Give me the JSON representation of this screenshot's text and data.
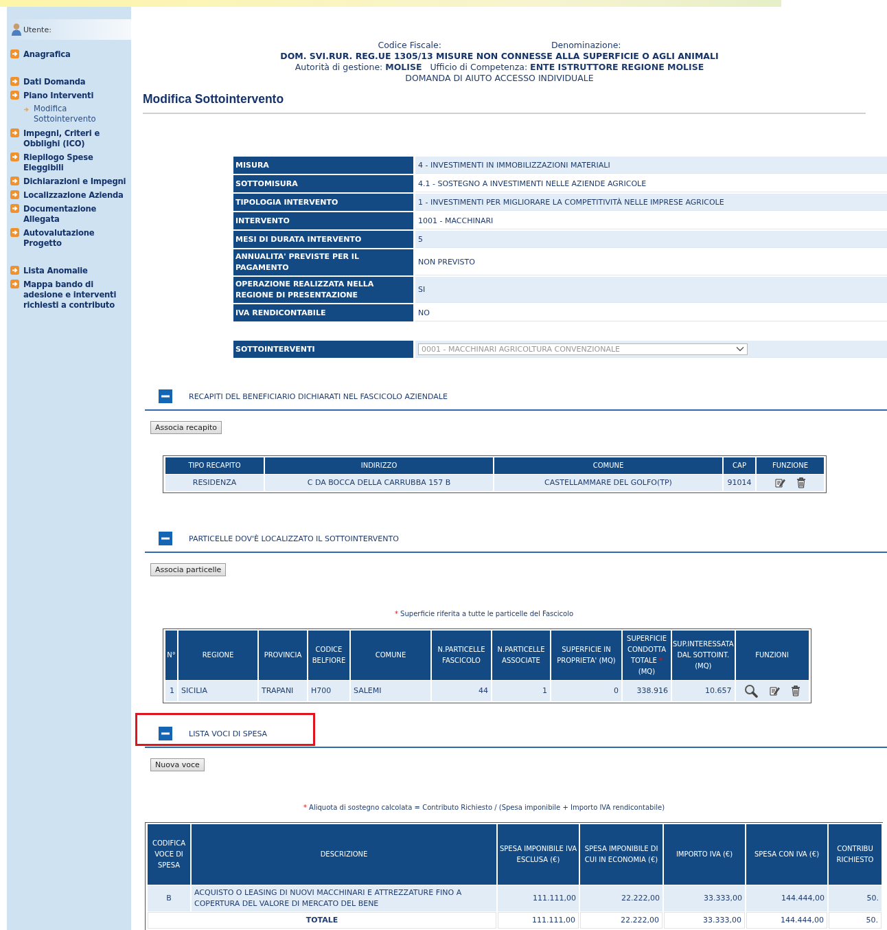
{
  "sidebar": {
    "user_label": "Utente:",
    "groups": [
      {
        "items": [
          {
            "label": "Anagrafica"
          }
        ]
      },
      {
        "items": [
          {
            "label": "Dati Domanda"
          },
          {
            "label": "Piano Interventi",
            "children": [
              {
                "label": "Modifica Sottointervento"
              }
            ]
          },
          {
            "label": "Impegni, Criteri e Obblighi (ICO)"
          },
          {
            "label": "Riepilogo Spese Eleggibili"
          },
          {
            "label": "Dichiarazioni e Impegni"
          },
          {
            "label": "Localizzazione Azienda"
          },
          {
            "label": "Documentazione Allegata"
          },
          {
            "label": "Autovalutazione Progetto"
          }
        ]
      },
      {
        "items": [
          {
            "label": "Lista Anomalie"
          },
          {
            "label": "Mappa bando di adesione e interventi richiesti a contributo"
          }
        ]
      }
    ]
  },
  "header": {
    "codice_fiscale_label": "Codice Fiscale:",
    "denominazione_label": "Denominazione:",
    "title": "DOM. SVI.RUR. REG.UE 1305/13 MISURE NON CONNESSE ALLA SUPERFICIE O AGLI ANIMALI",
    "authority": "Autorità di gestione: **MOLISE**   Ufficio di Competenza: **ENTE ISTRUTTORE REGIONE MOLISE**",
    "subtitle": "DOMANDA DI AIUTO ACCESSO INDIVIDUALE"
  },
  "page_title": "Modifica Sottointervento",
  "details": [
    {
      "label": "MISURA",
      "value": "4 - INVESTIMENTI IN IMMOBILIZZAZIONI MATERIALI"
    },
    {
      "label": "SOTTOMISURA",
      "value": "4.1 - SOSTEGNO A INVESTIMENTI NELLE AZIENDE AGRICOLE"
    },
    {
      "label": "TIPOLOGIA INTERVENTO",
      "value": "1 - INVESTIMENTI PER MIGLIORARE LA COMPETITIVITÀ NELLE IMPRESE AGRICOLE"
    },
    {
      "label": "INTERVENTO",
      "value": "1001 - MACCHINARI"
    },
    {
      "label": "MESI DI DURATA INTERVENTO",
      "value": "5"
    },
    {
      "label": "ANNUALITA' PREVISTE PER IL PAGAMENTO",
      "value": "NON PREVISTO"
    },
    {
      "label": "OPERAZIONE REALIZZATA NELLA REGIONE DI PRESENTAZIONE",
      "value": "SI"
    },
    {
      "label": "IVA RENDICONTABILE",
      "value": "NO"
    }
  ],
  "sottointerventi": {
    "label": "SOTTOINTERVENTI",
    "value": "0001 - MACCHINARI AGRICOLTURA CONVENZIONALE",
    "disabled": true
  },
  "sections": [
    {
      "title": "RECAPITI DEL BENEFICIARIO DICHIARATI NEL FASCICOLO AZIENDALE",
      "expanded": true,
      "button": "Associa recapito",
      "table": {
        "columns": [
          {
            "label": "TIPO RECAPITO",
            "kind": "center"
          },
          {
            "label": "INDIRIZZO",
            "kind": "center"
          },
          {
            "label": "COMUNE",
            "kind": "center"
          },
          {
            "label": "CAP",
            "kind": "center"
          },
          {
            "label": "FUNZIONE",
            "kind": "actions"
          }
        ],
        "rows": [
          {
            "cells": [
              "RESIDENZA",
              "C DA BOCCA DELLA CARRUBBA 157 B",
              "CASTELLAMMARE DEL GOLFO(TP)",
              "91014"
            ],
            "actions": [
              {
                "kind": "edit"
              },
              {
                "kind": "delete"
              }
            ]
          }
        ]
      }
    },
    {
      "title": "PARTICELLE DOV'È LOCALIZZATO IL SOTTOINTERVENTO",
      "expanded": true,
      "button": "Associa particelle",
      "note": {
        "mark": "*",
        "text": "Superficie riferita a tutte le particelle del Fascicolo"
      },
      "table": {
        "columns": [
          {
            "label": "N°",
            "kind": "number"
          },
          {
            "label": "REGIONE",
            "kind": "left"
          },
          {
            "label": "PROVINCIA",
            "kind": "left"
          },
          {
            "label": "CODICE BELFIORE",
            "kind": "left"
          },
          {
            "label": "COMUNE",
            "kind": "left"
          },
          {
            "label": "N.PARTICELLE FASCICOLO",
            "kind": "number"
          },
          {
            "label": "N.PARTICELLE ASSOCIATE",
            "kind": "number"
          },
          {
            "label": "SUPERFICIE IN PROPRIETA' (MQ)",
            "kind": "number"
          },
          {
            "label": "SUPERFICIE CONDOTTA TOTALE",
            "mark": "*",
            "unit": "(MQ)",
            "kind": "number"
          },
          {
            "label": "SUP.INTERESSATA DAL SOTTOINT. (MQ)",
            "kind": "number"
          },
          {
            "label": "FUNZIONI",
            "kind": "actions"
          }
        ],
        "rows": [
          {
            "cells": [
              "1",
              "SICILIA",
              "TRAPANI",
              "H700",
              "SALEMI",
              "44",
              "1",
              "0",
              "338.916",
              "10.657"
            ],
            "actions": [
              {
                "kind": "view"
              },
              {
                "kind": "edit"
              },
              {
                "kind": "delete"
              }
            ]
          }
        ]
      }
    },
    {
      "title": "LISTA VOCI DI SPESA",
      "expanded": true,
      "highlighted": true,
      "button": "Nuova voce",
      "note": {
        "mark": "*",
        "text": "Aliquota di sostegno calcolata = Contributo Richiesto / (Spesa imponibile + Importo IVA rendicontabile)"
      },
      "table": {
        "columns": [
          {
            "label": "CODIFICA VOCE DI SPESA",
            "kind": "center"
          },
          {
            "label": "DESCRIZIONE",
            "kind": "left"
          },
          {
            "label": "SPESA IMPONIBILE IVA ESCLUSA (€)",
            "kind": "number"
          },
          {
            "label": "SPESA IMPONIBILE DI CUI IN ECONOMIA (€)",
            "kind": "number"
          },
          {
            "label": "IMPORTO IVA (€)",
            "kind": "number"
          },
          {
            "label": "SPESA CON IVA (€)",
            "kind": "number"
          },
          {
            "label": "CONTRIBU RICHIESTO",
            "kind": "number"
          }
        ],
        "rows": [
          {
            "cells": [
              "B",
              "ACQUISTO O LEASING DI NUOVI MACCHINARI E ATTREZZATURE FINO A COPERTURA DEL VALORE DI MERCATO DEL BENE",
              "111.111,00",
              "22.222,00",
              "33.333,00",
              "144.444,00",
              "50."
            ]
          }
        ],
        "total": {
          "label": "TOTALE",
          "cells": [
            "111.111,00",
            "22.222,00",
            "33.333,00",
            "144.444,00",
            "50."
          ]
        }
      }
    }
  ]
}
